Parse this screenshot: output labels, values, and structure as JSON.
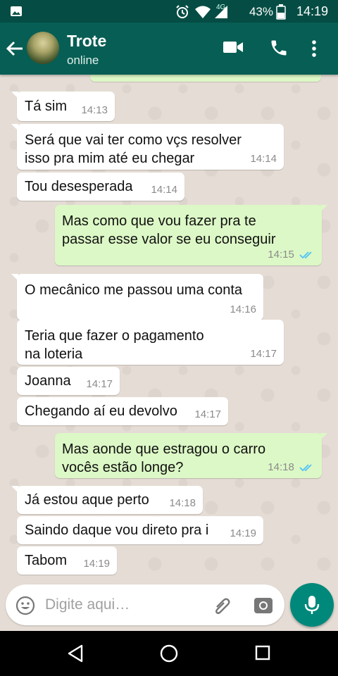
{
  "status_bar": {
    "time": "14:19",
    "battery": "43%",
    "network": "4G",
    "icons": [
      "image-icon",
      "alarm-icon",
      "wifi-icon",
      "signal-icon",
      "battery-icon"
    ]
  },
  "header": {
    "title": "Trote",
    "subtitle": "online",
    "icons": [
      "back-arrow-icon",
      "video-call-icon",
      "phone-icon",
      "more-vert-icon"
    ],
    "bg_color": "#075e54"
  },
  "messages": [
    {
      "dir": "in",
      "lines": [
        "Tá sim"
      ],
      "time": "14:13"
    },
    {
      "dir": "in",
      "lines": [
        "Será que vai ter como vçs resolver",
        "isso pra mim até eu chegar"
      ],
      "time": "14:14"
    },
    {
      "dir": "in",
      "lines": [
        "Tou desesperada"
      ],
      "time": "14:14"
    },
    {
      "dir": "out",
      "lines": [
        "Mas como que vou fazer pra te",
        "passar esse valor se eu conseguir"
      ],
      "time": "14:15",
      "read": true
    },
    {
      "dir": "in",
      "lines": [
        "O mecânico me passou uma conta"
      ],
      "time": "14:16"
    },
    {
      "dir": "in",
      "lines": [
        "Teria que fazer o pagamento",
        "na loteria"
      ],
      "time": "14:17"
    },
    {
      "dir": "in",
      "lines": [
        "Joanna"
      ],
      "time": "14:17"
    },
    {
      "dir": "in",
      "lines": [
        "Chegando aí eu devolvo"
      ],
      "time": "14:17"
    },
    {
      "dir": "out",
      "lines": [
        "Mas aonde que estragou o carro",
        "vocês estão longe?"
      ],
      "time": "14:18",
      "read": true
    },
    {
      "dir": "in",
      "lines": [
        "Já estou aque perto"
      ],
      "time": "14:18"
    },
    {
      "dir": "in",
      "lines": [
        "Saindo daque vou direto pra i"
      ],
      "time": "14:19"
    },
    {
      "dir": "in",
      "lines": [
        "Tabom"
      ],
      "time": "14:19"
    }
  ],
  "input": {
    "placeholder": "Digite aqui…",
    "icons": [
      "emoji-icon",
      "attach-icon",
      "camera-icon",
      "mic-icon"
    ]
  },
  "colors": {
    "accent": "#00897b",
    "outgoing_bubble": "#dcf8c6",
    "incoming_bubble": "#ffffff",
    "read_ticks": "#4fc3f7"
  }
}
